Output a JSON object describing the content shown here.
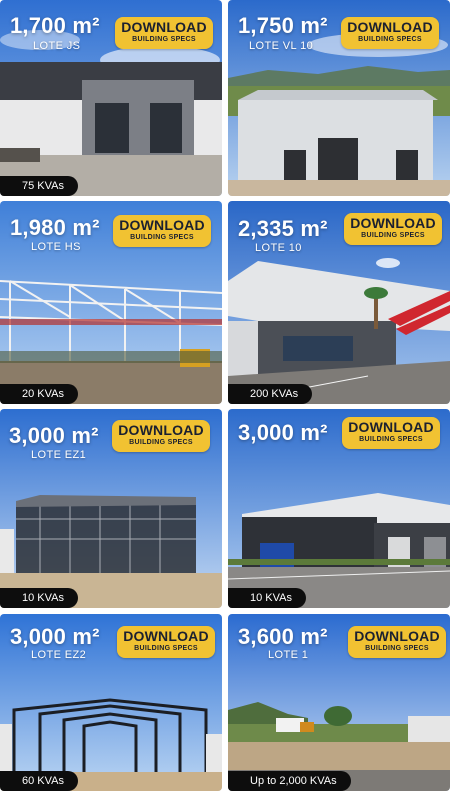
{
  "cards": [
    {
      "area": "1,700 m²",
      "lote": "LOTE JS",
      "download": "DOWNLOAD",
      "specs": "BUILDING SPECS",
      "power": "75 KVAs"
    },
    {
      "area": "1,750 m²",
      "lote": "LOTE VL 10",
      "download": "DOWNLOAD",
      "specs": "BUILDING SPECS",
      "power": ""
    },
    {
      "area": "1,980 m²",
      "lote": "LOTE HS",
      "download": "DOWNLOAD",
      "specs": "BUILDING SPECS",
      "power": "20 KVAs"
    },
    {
      "area": "2,335 m²",
      "lote": "LOTE 10",
      "download": "DOWNLOAD",
      "specs": "BUILDING SPECS",
      "power": "200 KVAs"
    },
    {
      "area": "3,000 m²",
      "lote": "LOTE EZ1",
      "download": "DOWNLOAD",
      "specs": "BUILDING SPECS",
      "power": "10 KVAs"
    },
    {
      "area": "3,000 m²",
      "lote": "",
      "download": "DOWNLOAD",
      "specs": "BUILDING SPECS",
      "power": "10 KVAs"
    },
    {
      "area": "3,000 m²",
      "lote": "LOTE EZ2",
      "download": "DOWNLOAD",
      "specs": "BUILDING SPECS",
      "power": "60 KVAs"
    },
    {
      "area": "3,600 m²",
      "lote": "LOTE 1",
      "download": "DOWNLOAD",
      "specs": "BUILDING SPECS",
      "power": "Up to 2,000 KVAs"
    }
  ],
  "colors": {
    "accent": "#f1c232",
    "sky": "#2f6fd1",
    "badge": "#0d0d0d"
  }
}
